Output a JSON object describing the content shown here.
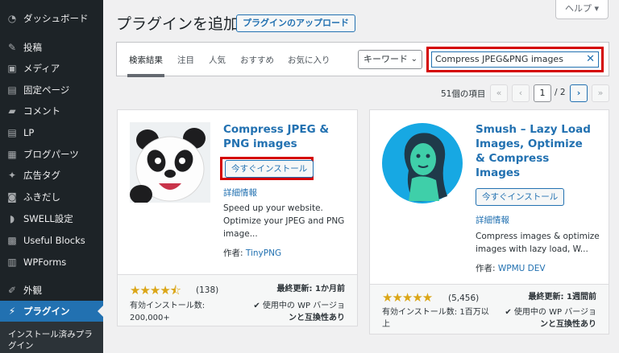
{
  "sidebar": {
    "items": [
      {
        "label": "ダッシュボード",
        "icon": "dashboard-icon",
        "glyph": "◔"
      },
      {
        "label": "投稿",
        "icon": "pin-icon",
        "glyph": "✎"
      },
      {
        "label": "メディア",
        "icon": "media-icon",
        "glyph": "▣"
      },
      {
        "label": "固定ページ",
        "icon": "page-icon",
        "glyph": "▤"
      },
      {
        "label": "コメント",
        "icon": "comment-icon",
        "glyph": "▰"
      },
      {
        "label": "LP",
        "icon": "page-icon",
        "glyph": "▤"
      },
      {
        "label": "ブログパーツ",
        "icon": "blog-parts-icon",
        "glyph": "▦"
      },
      {
        "label": "広告タグ",
        "icon": "ad-tag-icon",
        "glyph": "✦"
      },
      {
        "label": "ふきだし",
        "icon": "speech-bubble-icon",
        "glyph": "◙"
      },
      {
        "label": "SWELL設定",
        "icon": "swell-icon",
        "glyph": "◗"
      },
      {
        "label": "Useful Blocks",
        "icon": "blocks-icon",
        "glyph": "▩"
      },
      {
        "label": "WPForms",
        "icon": "forms-icon",
        "glyph": "▥"
      },
      {
        "label": "外観",
        "icon": "appearance-icon",
        "glyph": "✐"
      },
      {
        "label": "プラグイン",
        "icon": "plugin-icon",
        "glyph": "⚡"
      }
    ],
    "submenu_label": "インストール済みプラグイン"
  },
  "header": {
    "title": "プラグインを追加",
    "upload_label": "プラグインのアップロード",
    "help_label": "ヘルプ ▾"
  },
  "filter": {
    "tabs": [
      "検索結果",
      "注目",
      "人気",
      "おすすめ",
      "お気に入り"
    ],
    "search_type": "キーワード",
    "search_value": "Compress JPEG&PNG images",
    "clear_glyph": "✕"
  },
  "pagination": {
    "count_text": "51個の項目",
    "first": "«",
    "prev": "‹",
    "current_page": "1",
    "total_text": "/ 2",
    "next": "›",
    "last": "»"
  },
  "plugins": [
    {
      "name_line1": "Compress JPEG &",
      "name_line2": "PNG images",
      "install_label": "今すぐインストール",
      "details_label": "詳細情報",
      "desc_lines": [
        "Speed up your website.",
        "Optimize your JPEG and PNG",
        "image..."
      ],
      "author_prefix": "作者: ",
      "author": "TinyPNG",
      "stars": "★★★★⯪",
      "rating_count": "(138)",
      "rating": 4.5,
      "last_updated": "最終更新: 1か月前",
      "installs_line1": "有効インストール数:",
      "installs_line2": "200,000+",
      "compat_line1": "✔ 使用中の WP バージョ",
      "compat_line2": "ンと互換性あり"
    },
    {
      "name_line1": "Smush – Lazy Load",
      "name_line2": "Images, Optimize",
      "name_line3": "& Compress",
      "name_line4": "Images",
      "install_label": "今すぐインストール",
      "details_label": "詳細情報",
      "desc_lines": [
        "Compress images & optimize",
        "images with lazy load, W..."
      ],
      "author_prefix": "作者: ",
      "author": "WPMU DEV",
      "stars": "★★★★★",
      "rating_count": "(5,456)",
      "rating": 5,
      "last_updated": "最終更新: 1週間前",
      "installs_line1": "有効インストール数: 1百万以",
      "installs_line2": "上",
      "compat_line1": "✔ 使用中の WP バージョ",
      "compat_line2": "ンと互換性あり"
    }
  ],
  "colors": {
    "accent": "#2271b1",
    "sidebar": "#1d2327",
    "highlight": "#d40000",
    "star": "#dba617",
    "check": "#00a32a"
  }
}
